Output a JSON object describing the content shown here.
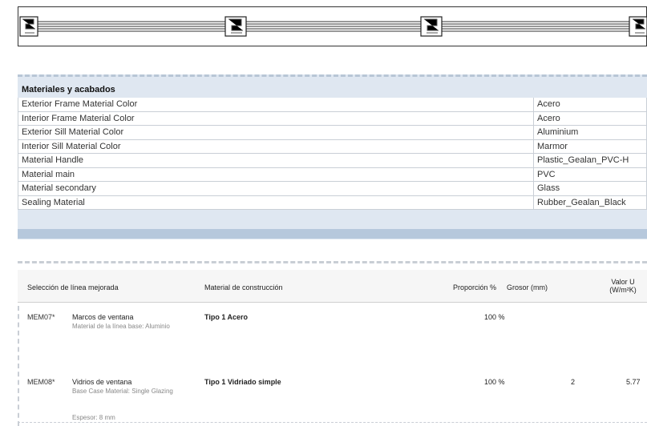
{
  "materials": {
    "title": "Materiales y acabados",
    "rows": [
      {
        "label": "Exterior Frame Material Color",
        "value": "Acero"
      },
      {
        "label": "Interior Frame Material Color",
        "value": "Acero"
      },
      {
        "label": "Exterior Sill Material Color",
        "value": "Aluminium"
      },
      {
        "label": "Interior Sill Material Color",
        "value": "Marmor"
      },
      {
        "label": "Material Handle",
        "value": "Plastic_Gealan_PVC-H"
      },
      {
        "label": "Material main",
        "value": "PVC"
      },
      {
        "label": "Material secondary",
        "value": "Glass"
      },
      {
        "label": "Sealing Material",
        "value": "Rubber_Gealan_Black"
      }
    ]
  },
  "selection": {
    "headers": {
      "line": "Selección de línea mejorada",
      "material": "Material de construcción",
      "proportion": "Proporción %",
      "thickness": "Grosor (mm)",
      "uvalue": "Valor U (W/m²K)"
    },
    "rows": [
      {
        "code": "MEM07*",
        "name": "Marcos de ventana",
        "sub": "Material de la línea base: Aluminio",
        "material": "Tipo 1  Acero",
        "proportion": "100 %",
        "thickness": "",
        "uvalue": ""
      },
      {
        "code": "MEM08*",
        "name": "Vidrios de ventana",
        "sub": "Base Case Material: Single Glazing",
        "sub2": "Espesor: 8 mm",
        "material": "Tipo 1  Vidriado simple",
        "proportion": "100 %",
        "thickness": "2",
        "uvalue": "5.77"
      }
    ]
  }
}
